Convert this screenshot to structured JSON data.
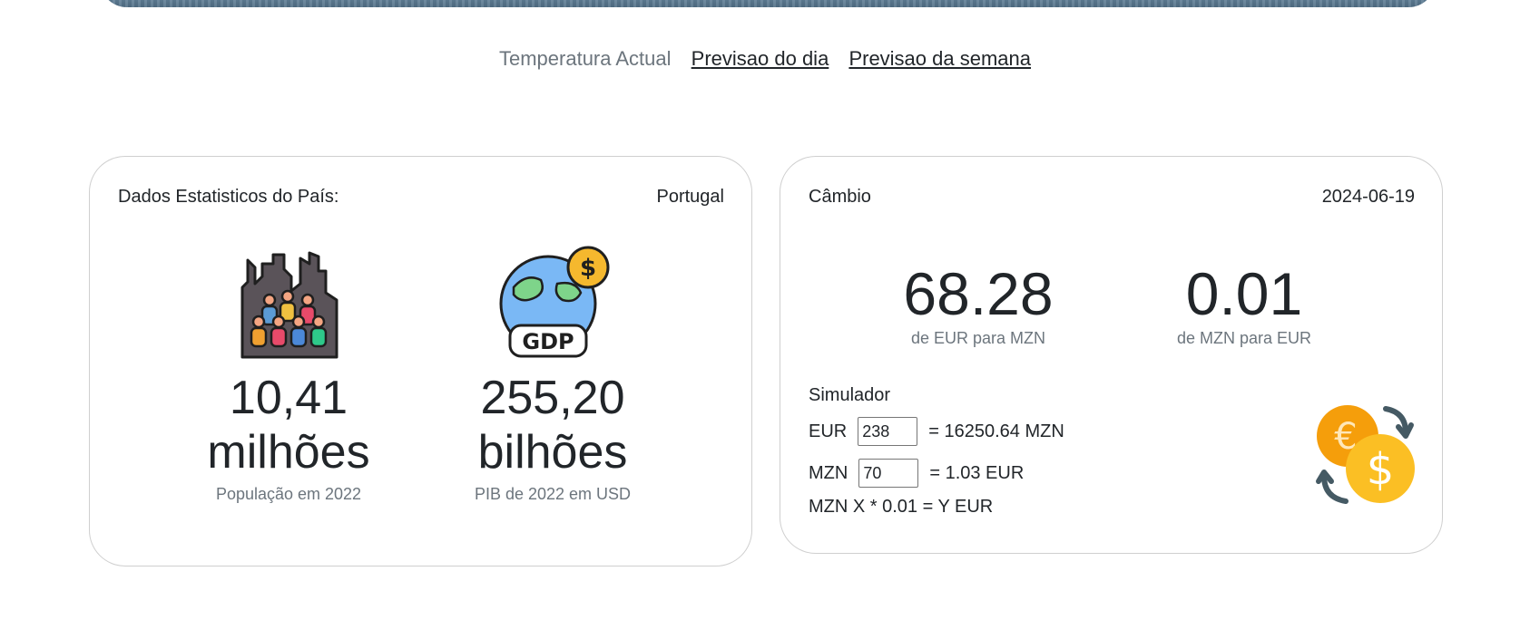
{
  "nav": {
    "current": "Temperatura Actual",
    "day": "Previsao do dia",
    "week": "Previsao da semana"
  },
  "stats": {
    "title": "Dados Estatisticos do País:",
    "country": "Portugal",
    "population": {
      "value": "10,41",
      "unit": "milhões",
      "caption": "População em 2022",
      "icon": "city-population-icon"
    },
    "gdp": {
      "value": "255,20",
      "unit": "bilhões",
      "caption": "PIB de 2022 em USD",
      "icon": "globe-gdp-icon",
      "icon_label": "GDP"
    }
  },
  "exchange": {
    "title": "Câmbio",
    "date": "2024-06-19",
    "eur_to_mzn": {
      "value": "68.28",
      "caption": "de EUR para MZN"
    },
    "mzn_to_eur": {
      "value": "0.01",
      "caption": "de MZN para EUR"
    },
    "simulator": {
      "title": "Simulador",
      "eur_label": "EUR",
      "eur_input": "238",
      "eur_result": "= 16250.64 MZN",
      "mzn_label": "MZN",
      "mzn_input": "70",
      "mzn_result": "= 1.03 EUR",
      "formula": "MZN X * 0.01 = Y EUR"
    },
    "icon": "currency-exchange-icon"
  },
  "colors": {
    "muted": "#6c757d",
    "text": "#212529",
    "coin_orange": "#f59e0b",
    "coin_yellow": "#fbbf24"
  }
}
